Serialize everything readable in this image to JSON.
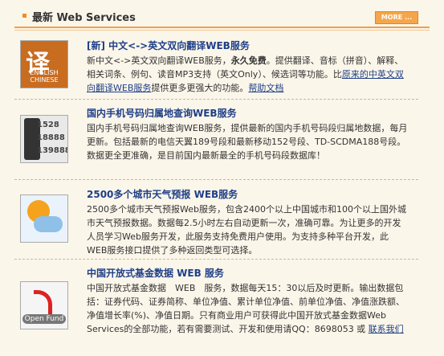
{
  "header": {
    "title": "最新 Web Services",
    "more_label": "MORE ..."
  },
  "items": [
    {
      "title": "[新] 中文<->英文双向翻译WEB服务",
      "desc_before": "新中文<->英文双向翻译WEB服务，",
      "desc_bold": "永久免费",
      "desc_mid": "。提供翻译、音标（拼音）、解释、相关词条、例句、读音MP3支持（英文Only）、候选词等功能。比",
      "link1": "原来的中英文双向翻译WEB服务",
      "desc_after": "提供更多更强大的功能。",
      "link2": "帮助文档",
      "thumb_char": "译",
      "thumb_text": "ENGLISH\nCHINESE"
    },
    {
      "title": "国内手机号码归属地查询WEB服务",
      "desc": "国内手机号码归属地查询WEB服务，提供最新的国内手机号码段归属地数据，每月更新。包括最新的电信天翼189号段和最新移动152号段、TD-SCDMA188号段。数据更全更准确，是目前国内最新最全的手机号码段数据库！",
      "thumb_numbers": [
        "1528",
        "18888",
        "139888"
      ]
    },
    {
      "title": "2500多个城市天气预报 WEB服务",
      "desc": "2500多个城市天气预报Web服务，包含2400个以上中国城市和100个以上国外城市天气预报数据。数据每2.5小时左右自动更新一次，准确可靠。为让更多的开发人员学习Web服务开发，此服务支持免费用户使用。为支持多种平台开发，此WEB服务接口提供了多种返回类型可选择。"
    },
    {
      "title": "中国开放式基金数据 WEB 服务",
      "desc": "中国开放式基金数据　WEB　服务，数据每天15：30以后及时更新。输出数据包括：证券代码、证券简称、单位净值、累计单位净值、前单位净值、净值涨跌额、净值增长率(%)、净值日期。只有商业用户可获得此中国开放式基金数据Web　Services的全部功能，若有需要测试、开发和使用请QQ：8698053 或",
      "link": "联系我们",
      "thumb_text": "Open Fund"
    }
  ]
}
